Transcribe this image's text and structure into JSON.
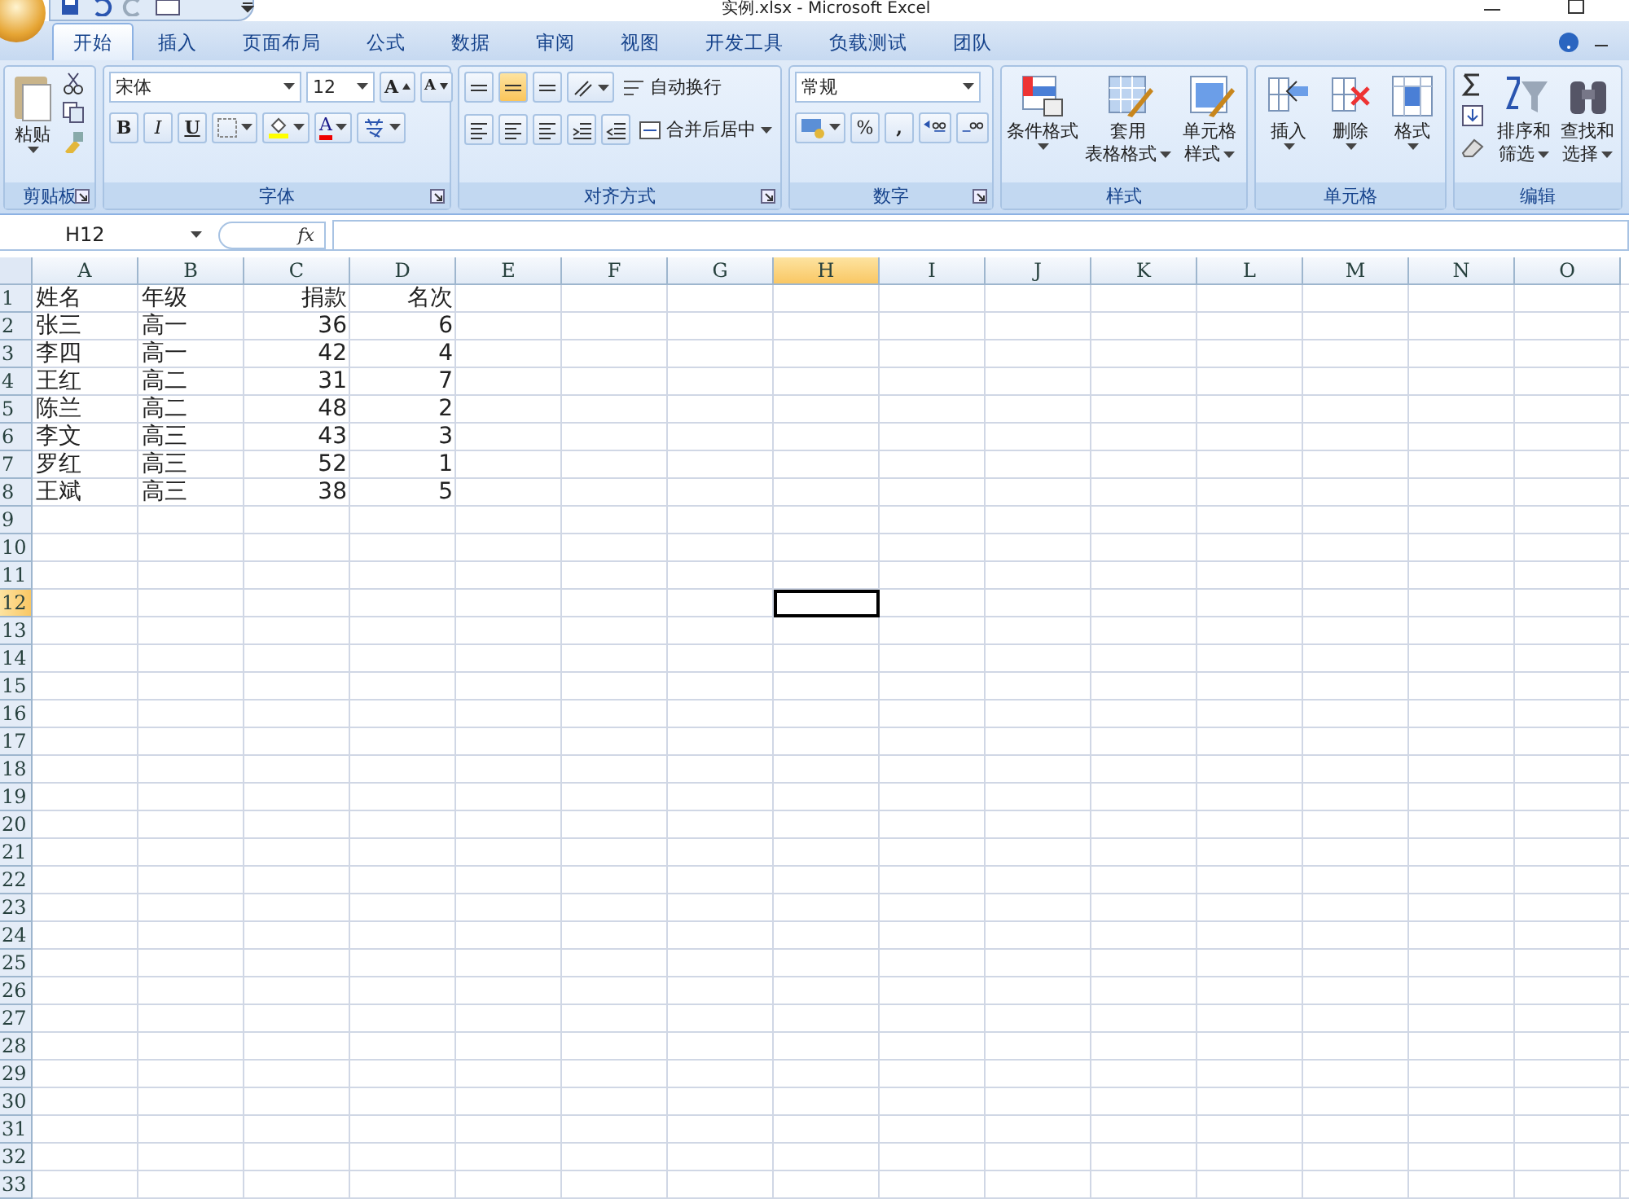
{
  "window": {
    "title": "实例.xlsx - Microsoft Excel"
  },
  "tabs": [
    {
      "label": "开始",
      "selected": true
    },
    {
      "label": "插入",
      "selected": false
    },
    {
      "label": "页面布局",
      "selected": false
    },
    {
      "label": "公式",
      "selected": false
    },
    {
      "label": "数据",
      "selected": false
    },
    {
      "label": "审阅",
      "selected": false
    },
    {
      "label": "视图",
      "selected": false
    },
    {
      "label": "开发工具",
      "selected": false
    },
    {
      "label": "负载测试",
      "selected": false
    },
    {
      "label": "团队",
      "selected": false
    }
  ],
  "ribbon": {
    "groups": [
      {
        "kind": "clipboard",
        "label": "剪贴板",
        "dialog_launcher": true,
        "paste": "粘贴"
      },
      {
        "kind": "font",
        "label": "字体",
        "dialog_launcher": true,
        "font": "宋体",
        "size": "12",
        "grow": "A",
        "shrink": "A",
        "bold": "B",
        "italic": "I",
        "underline": "U",
        "font_color": "A"
      },
      {
        "kind": "align",
        "label": "对齐方式",
        "dialog_launcher": true,
        "vertical": [
          {
            "selected": false
          },
          {
            "selected": true
          },
          {
            "selected": false
          }
        ],
        "wrap": "自动换行",
        "merge": "合并后居中"
      },
      {
        "kind": "number",
        "label": "数字",
        "dialog_launcher": true,
        "format": "常规",
        "percent": "%",
        "comma": ","
      },
      {
        "kind": "styles",
        "label": "样式",
        "dialog_launcher": false,
        "buttons": [
          {
            "lines": [
              "条件格式"
            ]
          },
          {
            "lines": [
              "套用",
              "表格格式"
            ]
          },
          {
            "lines": [
              "单元格",
              "样式"
            ]
          }
        ]
      },
      {
        "kind": "cells",
        "label": "单元格",
        "dialog_launcher": false,
        "buttons": [
          {
            "lines": [
              "插入"
            ]
          },
          {
            "lines": [
              "删除"
            ]
          },
          {
            "lines": [
              "格式"
            ]
          }
        ]
      },
      {
        "kind": "editing",
        "label": "编辑",
        "dialog_launcher": false,
        "buttons": [
          {
            "lines": [
              "排序和",
              "筛选"
            ]
          },
          {
            "lines": [
              "查找和",
              "选择"
            ]
          }
        ]
      }
    ]
  },
  "formula_bar": {
    "name_box": "H12",
    "fx": "fx"
  },
  "sheet": {
    "columns": [
      {
        "label": "A",
        "kind": "text",
        "selected": false
      },
      {
        "label": "B",
        "kind": "text",
        "selected": false
      },
      {
        "label": "C",
        "kind": "number",
        "selected": false
      },
      {
        "label": "D",
        "kind": "number",
        "selected": false
      },
      {
        "label": "E",
        "selected": false
      },
      {
        "label": "F",
        "selected": false
      },
      {
        "label": "G",
        "selected": false
      },
      {
        "label": "H",
        "selected": true
      },
      {
        "label": "I",
        "selected": false
      },
      {
        "label": "J",
        "selected": false
      },
      {
        "label": "K",
        "selected": false
      },
      {
        "label": "L",
        "selected": false
      },
      {
        "label": "M",
        "selected": false
      },
      {
        "label": "N",
        "selected": false
      },
      {
        "label": "O",
        "selected": false
      }
    ],
    "rows": [
      {
        "label": "1",
        "selected": false,
        "cells": [
          "姓名",
          "年级",
          "捐款",
          "名次"
        ]
      },
      {
        "label": "2",
        "selected": false,
        "cells": [
          "张三",
          "高一",
          "36",
          "6"
        ]
      },
      {
        "label": "3",
        "selected": false,
        "cells": [
          "李四",
          "高一",
          "42",
          "4"
        ]
      },
      {
        "label": "4",
        "selected": false,
        "cells": [
          "王红",
          "高二",
          "31",
          "7"
        ]
      },
      {
        "label": "5",
        "selected": false,
        "cells": [
          "陈兰",
          "高二",
          "48",
          "2"
        ]
      },
      {
        "label": "6",
        "selected": false,
        "cells": [
          "李文",
          "高三",
          "43",
          "3"
        ]
      },
      {
        "label": "7",
        "selected": false,
        "cells": [
          "罗红",
          "高三",
          "52",
          "1"
        ]
      },
      {
        "label": "8",
        "selected": false,
        "cells": [
          "王斌",
          "高三",
          "38",
          "5"
        ]
      },
      {
        "label": "9",
        "selected": false
      },
      {
        "label": "10",
        "selected": false
      },
      {
        "label": "11",
        "selected": false
      },
      {
        "label": "12",
        "selected": true
      },
      {
        "label": "13",
        "selected": false
      },
      {
        "label": "14",
        "selected": false
      },
      {
        "label": "15",
        "selected": false
      },
      {
        "label": "16",
        "selected": false
      },
      {
        "label": "17",
        "selected": false
      },
      {
        "label": "18",
        "selected": false
      },
      {
        "label": "19",
        "selected": false
      },
      {
        "label": "20",
        "selected": false
      },
      {
        "label": "21",
        "selected": false
      },
      {
        "label": "22",
        "selected": false
      },
      {
        "label": "23",
        "selected": false
      },
      {
        "label": "24",
        "selected": false
      },
      {
        "label": "25",
        "selected": false
      },
      {
        "label": "26",
        "selected": false
      },
      {
        "label": "27",
        "selected": false
      },
      {
        "label": "28",
        "selected": false
      },
      {
        "label": "29",
        "selected": false
      },
      {
        "label": "30",
        "selected": false
      },
      {
        "label": "31",
        "selected": false
      },
      {
        "label": "32",
        "selected": false
      },
      {
        "label": "33",
        "selected": false
      }
    ]
  }
}
